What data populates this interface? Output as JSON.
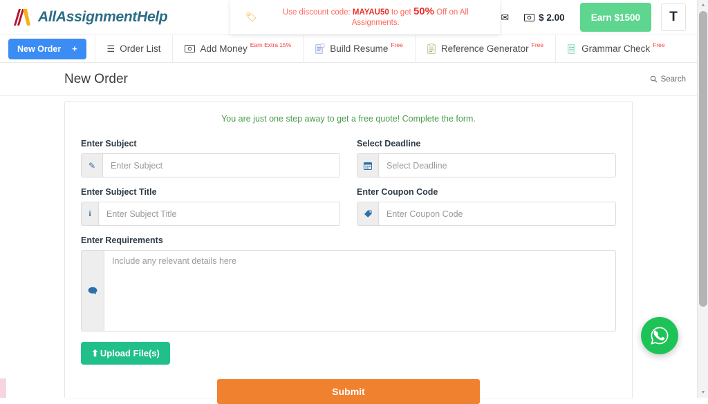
{
  "header": {
    "logo_text": "AllAssignmentHelp",
    "promo": {
      "icon": "tag-icon",
      "prefix": "Use discount code: ",
      "code": "MAYAU50",
      "middle": " to get ",
      "percent": "50%",
      "suffix": " Off on All Assignments."
    },
    "mail_icon": "envelope-icon",
    "balance_icon": "money-bill-icon",
    "balance": "$ 2.00",
    "earn_button": "Earn $1500",
    "avatar_initial": "T"
  },
  "nav": {
    "new_order": "New Order",
    "new_order_plus": "+",
    "items": [
      {
        "label": "Order List",
        "icon": "list-icon",
        "badge": ""
      },
      {
        "label": "Add Money",
        "icon": "money-bill-icon",
        "badge": "Earn Extra 15%"
      },
      {
        "label": "Build Resume",
        "icon": "resume-document-icon",
        "badge": "Free"
      },
      {
        "label": "Reference Generator",
        "icon": "clipboard-icon",
        "badge": "Free"
      },
      {
        "label": "Grammar Check",
        "icon": "check-document-icon",
        "badge": "Free"
      }
    ]
  },
  "page": {
    "title": "New Order",
    "search_label": "Search",
    "search_icon": "search-icon"
  },
  "form": {
    "note": "You are just one step away to get a free quote! Complete the form.",
    "fields": {
      "subject": {
        "label": "Enter Subject",
        "placeholder": "Enter Subject",
        "value": "",
        "icon": "pencil-icon"
      },
      "deadline": {
        "label": "Select Deadline",
        "placeholder": "Select Deadline",
        "value": "",
        "icon": "calendar-icon"
      },
      "subject_title": {
        "label": "Enter Subject Title",
        "placeholder": "Enter Subject Title",
        "value": "",
        "icon": "info-icon"
      },
      "coupon": {
        "label": "Enter Coupon Code",
        "placeholder": "Enter Coupon Code",
        "value": "",
        "icon": "tag-icon"
      },
      "requirements": {
        "label": "Enter Requirements",
        "placeholder": "Include any relevant details here",
        "value": "",
        "icon": "comment-icon"
      }
    },
    "upload_button": "Upload File(s)",
    "submit_button": "Submit"
  },
  "floating": {
    "whatsapp": "whatsapp-icon"
  },
  "colors": {
    "brand_teal": "#2b6d86",
    "promo_red": "#e8342a",
    "accent_blue": "#3b8cf4",
    "green_earn": "#5fd68f",
    "green_upload": "#21c08a",
    "orange_submit": "#f0812f",
    "note_green": "#4a9b4a",
    "whatsapp_green": "#1ec357"
  }
}
